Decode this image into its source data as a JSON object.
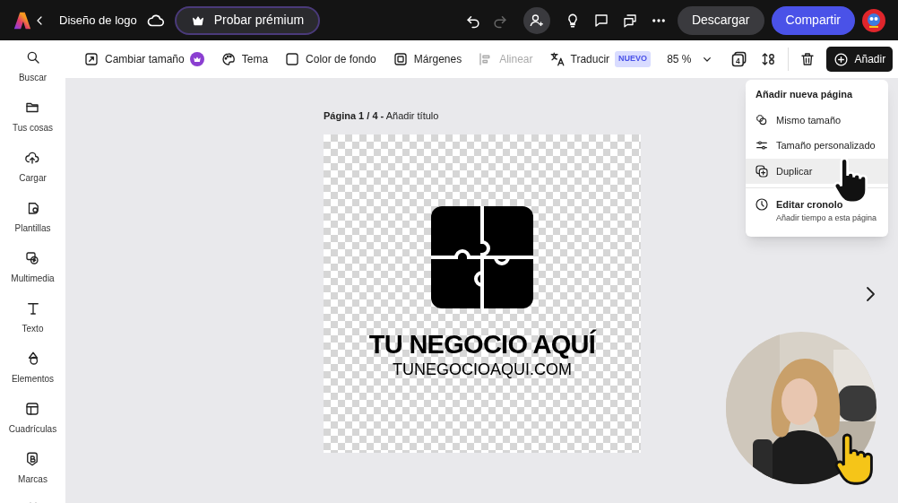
{
  "topbar": {
    "title": "Diseño de logo",
    "premium_button": "Probar prémium",
    "download_button": "Descargar",
    "share_button": "Compartir"
  },
  "sidebar": {
    "items": [
      {
        "label": "Buscar"
      },
      {
        "label": "Tus cosas"
      },
      {
        "label": "Cargar"
      },
      {
        "label": "Plantillas"
      },
      {
        "label": "Multimedia"
      },
      {
        "label": "Texto"
      },
      {
        "label": "Elementos"
      },
      {
        "label": "Cuadrículas"
      },
      {
        "label": "Marcas"
      }
    ]
  },
  "toolbar": {
    "items": [
      {
        "label": "Cambiar tamaño",
        "premium": true,
        "disabled": false
      },
      {
        "label": "Tema",
        "premium": false,
        "disabled": false
      },
      {
        "label": "Color de fondo",
        "premium": false,
        "disabled": false
      },
      {
        "label": "Márgenes",
        "premium": false,
        "disabled": false
      },
      {
        "label": "Alinear",
        "premium": false,
        "disabled": true
      },
      {
        "label": "Traducir",
        "premium": false,
        "disabled": false,
        "badge": "NUEVO"
      }
    ],
    "zoom": "85 %",
    "page_count": "4",
    "add_button": "Añadir"
  },
  "page_label": "**Página 1 / 4 -** Añadir título",
  "logo": {
    "title": "TU NEGOCIO AQUÍ",
    "url": "TUNEGOCIOAQUI.COM"
  },
  "menu": {
    "title": "Añadir nueva página",
    "items": [
      {
        "label": "Mismo tamaño",
        "selected": false
      },
      {
        "label": "Tamaño personalizado",
        "selected": false
      },
      {
        "label": "Duplicar",
        "selected": true
      },
      {
        "label": "Editar cronolo",
        "subtitle": "Añadir tiempo a esta página",
        "selected": false
      }
    ]
  }
}
